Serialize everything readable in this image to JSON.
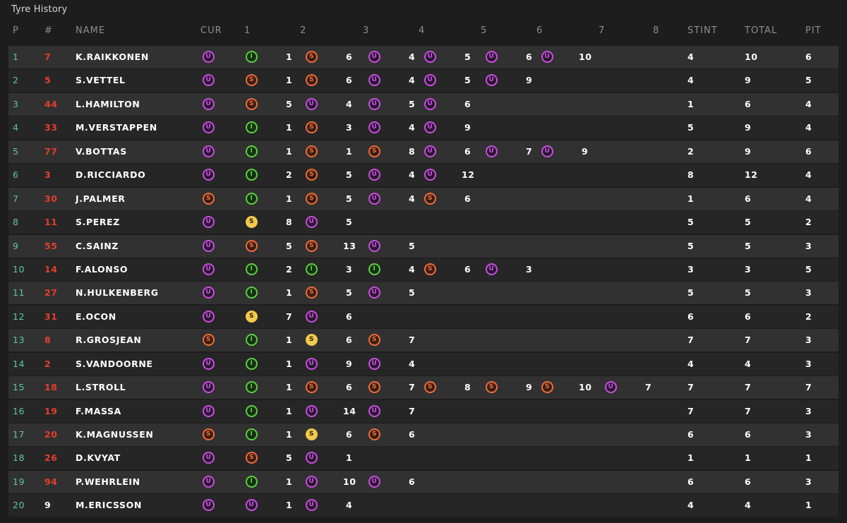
{
  "title": "Tyre History",
  "headers": {
    "p": "P",
    "num": "#",
    "name": "NAME",
    "cur": "CUR",
    "stints": [
      "1",
      "2",
      "3",
      "4",
      "5",
      "6",
      "7",
      "8"
    ],
    "stint": "STINT",
    "total": "TOTAL",
    "pit": "PIT"
  },
  "tyre_colors": {
    "U": "#c94fe0",
    "S": "#f06c3c",
    "I": "#5ccf42",
    "Y": "#f2c94c"
  },
  "rows": [
    {
      "p": "1",
      "num": "7",
      "name": "K.RAIKKONEN",
      "cur": "U",
      "stints": [
        [
          "I",
          "1"
        ],
        [
          "S",
          "6"
        ],
        [
          "U",
          "4"
        ],
        [
          "U",
          "5"
        ],
        [
          "U",
          "6"
        ],
        [
          "U",
          "10"
        ]
      ],
      "stint": "4",
      "total": "10",
      "pit": "6"
    },
    {
      "p": "2",
      "num": "5",
      "name": "S.VETTEL",
      "cur": "U",
      "stints": [
        [
          "S",
          "1"
        ],
        [
          "S",
          "6"
        ],
        [
          "U",
          "4"
        ],
        [
          "U",
          "5"
        ],
        [
          "U",
          "9"
        ]
      ],
      "stint": "4",
      "total": "9",
      "pit": "5"
    },
    {
      "p": "3",
      "num": "44",
      "name": "L.HAMILTON",
      "cur": "U",
      "stints": [
        [
          "S",
          "5"
        ],
        [
          "U",
          "4"
        ],
        [
          "U",
          "5"
        ],
        [
          "U",
          "6"
        ]
      ],
      "stint": "1",
      "total": "6",
      "pit": "4"
    },
    {
      "p": "4",
      "num": "33",
      "name": "M.VERSTAPPEN",
      "cur": "U",
      "stints": [
        [
          "I",
          "1"
        ],
        [
          "S",
          "3"
        ],
        [
          "U",
          "4"
        ],
        [
          "U",
          "9"
        ]
      ],
      "stint": "5",
      "total": "9",
      "pit": "4"
    },
    {
      "p": "5",
      "num": "77",
      "name": "V.BOTTAS",
      "cur": "U",
      "stints": [
        [
          "I",
          "1"
        ],
        [
          "S",
          "1"
        ],
        [
          "S",
          "8"
        ],
        [
          "U",
          "6"
        ],
        [
          "U",
          "7"
        ],
        [
          "U",
          "9"
        ]
      ],
      "stint": "2",
      "total": "9",
      "pit": "6"
    },
    {
      "p": "6",
      "num": "3",
      "name": "D.RICCIARDO",
      "cur": "U",
      "stints": [
        [
          "I",
          "2"
        ],
        [
          "S",
          "5"
        ],
        [
          "U",
          "4"
        ],
        [
          "U",
          "12"
        ]
      ],
      "stint": "8",
      "total": "12",
      "pit": "4"
    },
    {
      "p": "7",
      "num": "30",
      "name": "J.PALMER",
      "cur": "S",
      "stints": [
        [
          "I",
          "1"
        ],
        [
          "S",
          "5"
        ],
        [
          "U",
          "4"
        ],
        [
          "S",
          "6"
        ]
      ],
      "stint": "1",
      "total": "6",
      "pit": "4"
    },
    {
      "p": "8",
      "num": "11",
      "name": "S.PEREZ",
      "cur": "U",
      "stints": [
        [
          "Y",
          "8"
        ],
        [
          "U",
          "5"
        ]
      ],
      "stint": "5",
      "total": "5",
      "pit": "2"
    },
    {
      "p": "9",
      "num": "55",
      "name": "C.SAINZ",
      "cur": "U",
      "stints": [
        [
          "S",
          "5"
        ],
        [
          "S",
          "13"
        ],
        [
          "U",
          "5"
        ]
      ],
      "stint": "5",
      "total": "5",
      "pit": "3"
    },
    {
      "p": "10",
      "num": "14",
      "name": "F.ALONSO",
      "cur": "U",
      "stints": [
        [
          "I",
          "2"
        ],
        [
          "I",
          "3"
        ],
        [
          "I",
          "4"
        ],
        [
          "S",
          "6"
        ],
        [
          "U",
          "3"
        ]
      ],
      "stint": "3",
      "total": "3",
      "pit": "5"
    },
    {
      "p": "11",
      "num": "27",
      "name": "N.HULKENBERG",
      "cur": "U",
      "stints": [
        [
          "I",
          "1"
        ],
        [
          "S",
          "5"
        ],
        [
          "U",
          "5"
        ]
      ],
      "stint": "5",
      "total": "5",
      "pit": "3"
    },
    {
      "p": "12",
      "num": "31",
      "name": "E.OCON",
      "cur": "U",
      "stints": [
        [
          "Y",
          "7"
        ],
        [
          "U",
          "6"
        ]
      ],
      "stint": "6",
      "total": "6",
      "pit": "2"
    },
    {
      "p": "13",
      "num": "8",
      "name": "R.GROSJEAN",
      "cur": "S",
      "stints": [
        [
          "I",
          "1"
        ],
        [
          "Y",
          "6"
        ],
        [
          "S",
          "7"
        ]
      ],
      "stint": "7",
      "total": "7",
      "pit": "3"
    },
    {
      "p": "14",
      "num": "2",
      "name": "S.VANDOORNE",
      "cur": "U",
      "stints": [
        [
          "I",
          "1"
        ],
        [
          "U",
          "9"
        ],
        [
          "U",
          "4"
        ]
      ],
      "stint": "4",
      "total": "4",
      "pit": "3"
    },
    {
      "p": "15",
      "num": "18",
      "name": "L.STROLL",
      "cur": "U",
      "stints": [
        [
          "I",
          "1"
        ],
        [
          "S",
          "6"
        ],
        [
          "S",
          "7"
        ],
        [
          "S",
          "8"
        ],
        [
          "S",
          "9"
        ],
        [
          "S",
          "10"
        ],
        [
          "U",
          "7"
        ]
      ],
      "stint": "7",
      "total": "7",
      "pit": "7"
    },
    {
      "p": "16",
      "num": "19",
      "name": "F.MASSA",
      "cur": "U",
      "stints": [
        [
          "I",
          "1"
        ],
        [
          "U",
          "14"
        ],
        [
          "U",
          "7"
        ]
      ],
      "stint": "7",
      "total": "7",
      "pit": "3"
    },
    {
      "p": "17",
      "num": "20",
      "name": "K.MAGNUSSEN",
      "cur": "S",
      "stints": [
        [
          "I",
          "1"
        ],
        [
          "Y",
          "6"
        ],
        [
          "S",
          "6"
        ]
      ],
      "stint": "6",
      "total": "6",
      "pit": "3"
    },
    {
      "p": "18",
      "num": "26",
      "name": "D.KVYAT",
      "cur": "U",
      "stints": [
        [
          "S",
          "5"
        ],
        [
          "U",
          "1"
        ]
      ],
      "stint": "1",
      "total": "1",
      "pit": "1"
    },
    {
      "p": "19",
      "num": "94",
      "name": "P.WEHRLEIN",
      "cur": "U",
      "stints": [
        [
          "I",
          "1"
        ],
        [
          "U",
          "10"
        ],
        [
          "U",
          "6"
        ]
      ],
      "stint": "6",
      "total": "6",
      "pit": "3"
    },
    {
      "p": "20",
      "num": "9",
      "name": "M.ERICSSON",
      "cur": "U",
      "stints": [
        [
          "U",
          "1"
        ],
        [
          "U",
          "4"
        ]
      ],
      "stint": "4",
      "total": "4",
      "pit": "1"
    }
  ]
}
